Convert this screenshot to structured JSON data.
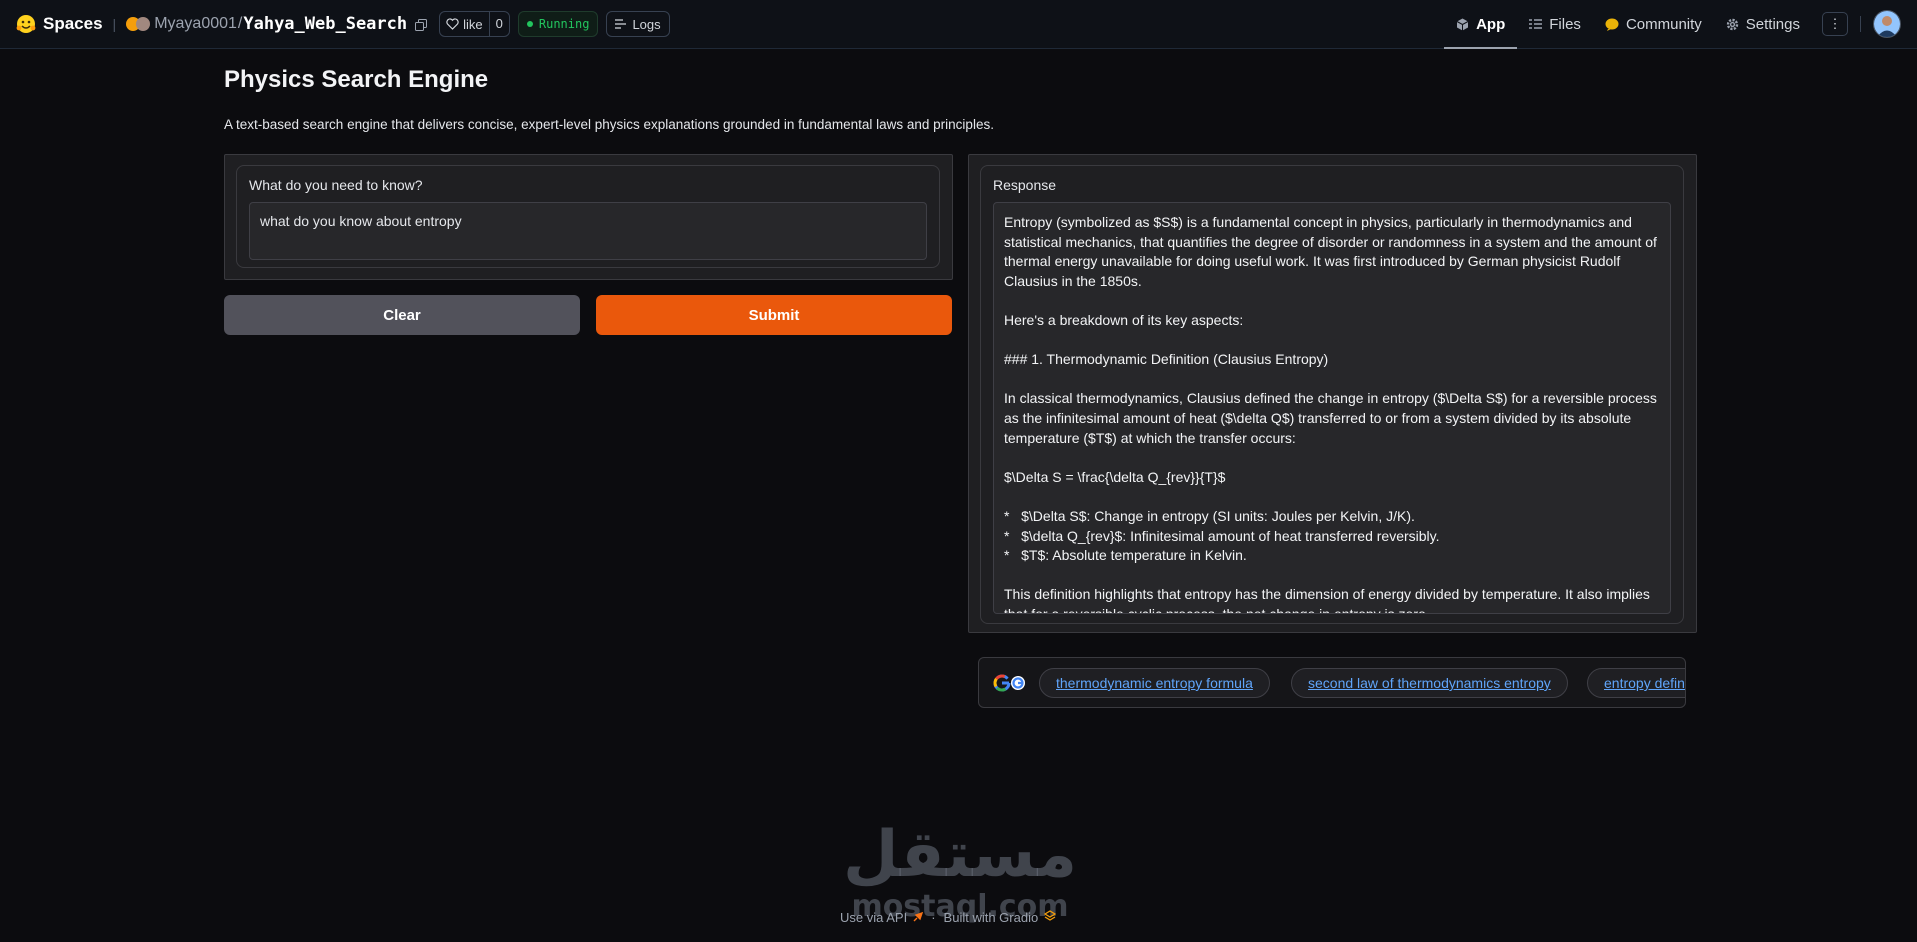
{
  "topbar": {
    "spaces_label": "Spaces",
    "owner": "Myaya0001",
    "slash": "/",
    "repo": "Yahya_Web_Search",
    "like_label": "like",
    "like_count": "0",
    "status": "Running",
    "logs_label": "Logs",
    "nav": {
      "app": "App",
      "files": "Files",
      "community": "Community",
      "settings": "Settings"
    }
  },
  "page": {
    "title": "Physics Search Engine",
    "description": "A text-based search engine that delivers concise, expert-level physics explanations grounded in fundamental laws and principles."
  },
  "query": {
    "label": "What do you need to know?",
    "value": "what do you know about entropy"
  },
  "buttons": {
    "clear": "Clear",
    "submit": "Submit"
  },
  "response": {
    "label": "Response",
    "paragraphs": {
      "p1": "Entropy (symbolized as $S$) is a fundamental concept in physics, particularly in thermodynamics and statistical mechanics, that quantifies the degree of disorder or randomness in a system and the amount of thermal energy unavailable for doing useful work. It was first introduced by German physicist Rudolf Clausius in the 1850s.",
      "p2": "Here's a breakdown of its key aspects:",
      "p3": "### 1. Thermodynamic Definition (Clausius Entropy)",
      "p4": "In classical thermodynamics, Clausius defined the change in entropy ($\\Delta S$) for a reversible process as the infinitesimal amount of heat ($\\delta Q$) transferred to or from a system divided by its absolute temperature ($T$) at which the transfer occurs:",
      "p5": "$\\Delta S = \\frac{\\delta Q_{rev}}{T}$",
      "li1": "*   $\\Delta S$: Change in entropy (SI units: Joules per Kelvin, J/K).",
      "li2": "*   $\\delta Q_{rev}$: Infinitesimal amount of heat transferred reversibly.",
      "li3": "*   $T$: Absolute temperature in Kelvin.",
      "p6": "This definition highlights that entropy has the dimension of energy divided by temperature. It also implies that for a reversible cyclic process, the net change in entropy is zero."
    }
  },
  "suggestions": [
    "thermodynamic entropy formula",
    "second law of thermodynamics entropy",
    "entropy definition"
  ],
  "footer": {
    "api": "Use via API",
    "separator": "·",
    "built": "Built with Gradio"
  },
  "watermark": {
    "arabic": "مستقل",
    "latin": "mostaql.com"
  },
  "colors": {
    "accent": "#ea580c",
    "running": "#22c55e",
    "link": "#60a5fa"
  }
}
